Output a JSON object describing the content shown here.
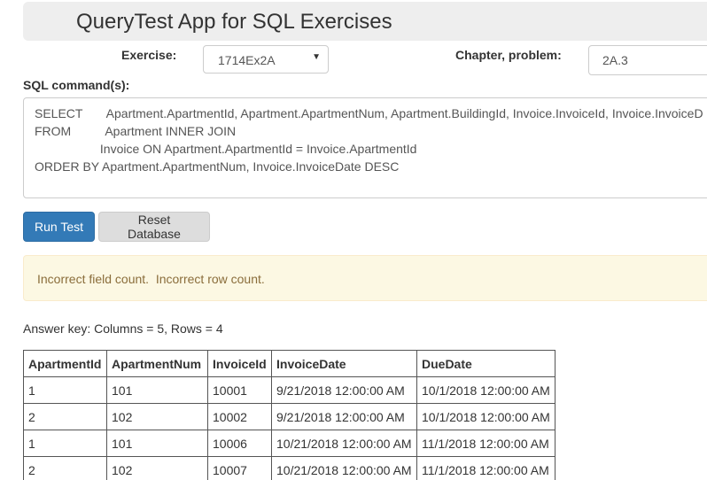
{
  "header": {
    "title": "QueryTest App for SQL Exercises"
  },
  "exercise": {
    "label": "Exercise:",
    "selected": "1714Ex2A"
  },
  "chapter": {
    "label": "Chapter, problem:",
    "value": "2A.3"
  },
  "sql": {
    "label": "SQL command(s):",
    "lines": [
      "SELECT       Apartment.ApartmentId, Apartment.ApartmentNum, Apartment.BuildingId, Invoice.InvoiceId, Invoice.InvoiceD",
      "FROM          Apartment INNER JOIN",
      "                   Invoice ON Apartment.ApartmentId = Invoice.ApartmentId",
      "ORDER BY Apartment.ApartmentNum, Invoice.InvoiceDate DESC"
    ]
  },
  "buttons": {
    "run_label": "Run Test",
    "reset_label": "Reset Database"
  },
  "alert": {
    "message": "Incorrect field count.  Incorrect row count."
  },
  "answer_key": {
    "text": "Answer key: Columns = 5, Rows = 4"
  },
  "table": {
    "headers": [
      "ApartmentId",
      "ApartmentNum",
      "InvoiceId",
      "InvoiceDate",
      "DueDate"
    ],
    "rows": [
      [
        "1",
        "101",
        "10001",
        "9/21/2018 12:00:00 AM",
        "10/1/2018 12:00:00 AM"
      ],
      [
        "2",
        "102",
        "10002",
        "9/21/2018 12:00:00 AM",
        "10/1/2018 12:00:00 AM"
      ],
      [
        "1",
        "101",
        "10006",
        "10/21/2018 12:00:00 AM",
        "11/1/2018 12:00:00 AM"
      ],
      [
        "2",
        "102",
        "10007",
        "10/21/2018 12:00:00 AM",
        "11/1/2018 12:00:00 AM"
      ]
    ]
  },
  "colors": {
    "primary": "#337ab7",
    "warning_bg": "#fcf8e3",
    "warning_text": "#8a6d3b",
    "header_bg": "#eeeeee"
  }
}
